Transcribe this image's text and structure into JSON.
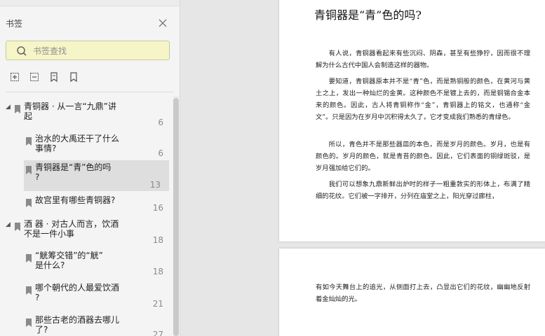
{
  "panel": {
    "title": "书签",
    "search_placeholder": "书签查找"
  },
  "bookmarks": [
    {
      "label": "青铜器 · 从一言“九鼎”讲\n起",
      "page": "6",
      "level": 0,
      "expanded": true
    },
    {
      "label": "治水的大禹还干了什么\n事情?",
      "page": "6",
      "level": 1
    },
    {
      "label": "青铜器是“青”色的吗\n?",
      "page": "13",
      "level": 1,
      "selected": true
    },
    {
      "label": "故宫里有哪些青铜器?",
      "page": "16",
      "level": 1
    },
    {
      "label": "酒  器 · 对古人而言，饮酒\n不是一件小事",
      "page": "18",
      "level": 0,
      "expanded": true
    },
    {
      "label": "“觥筹交错”的“觥”\n是什么?",
      "page": "18",
      "level": 1
    },
    {
      "label": "哪个朝代的人最爱饮酒\n?",
      "page": "21",
      "level": 1
    },
    {
      "label": "那些古老的酒器去哪儿\n了?",
      "page": "27",
      "level": 1
    }
  ],
  "document": {
    "title": "青铜器是“青”色的吗?",
    "page1_paragraphs": [
      "有人说，青铜器看起来有些沉闷、阴森，甚至有些狰狞，因而很不理解为什么古代中国人会制造这样的器物。",
      "要知道，青铜器原本并不是“青”色，而是熟铜般的颜色，在黄河与黄土之上，发出一种灿烂的金黄。这种颜色不是镀上去的，而是铜锡合金本来的颜色。因此，古人将青铜称作“金”，青铜器上的铭文，也通称“金文”。只是因为在岁月中沉积得太久了，它才变成我们熟悉的青绿色。",
      "所以，青色并不是那些器皿的本色，而是岁月的颜色。岁月，也是有颜色的。岁月的颜色，就是青苔的颜色。因此，它们表面的铜绿斑驳，是岁月强加给它们的。",
      "我们可以想象九鼎新鲜出炉时的样子一粗重敦实的形体上，布满了精细的花纹。它们被一字排开，分列在庙堂之上，阳光穿过廊柱，"
    ],
    "page2_paragraphs": [
      "有如今天舞台上的追光，从侧面打上去，凸显出它们的花纹，幽幽地反射着金灿灿的光。"
    ]
  }
}
